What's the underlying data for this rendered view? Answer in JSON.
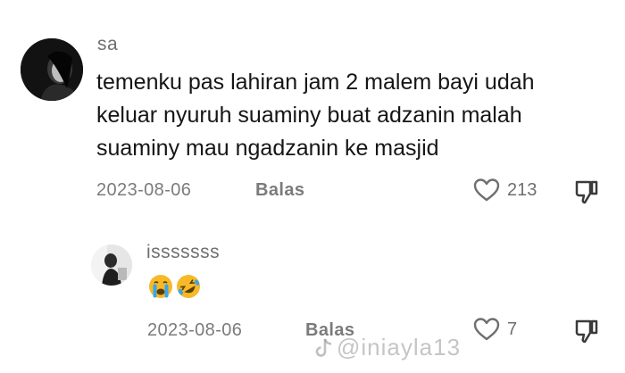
{
  "comment": {
    "username": "sa",
    "text_lines": [
      "temenku pas lahiran jam 2 malem bayi udah",
      "keluar nyuruh suaminy buat adzanin malah",
      "suaminy mau ngadzanin ke masjid"
    ],
    "date": "2023-08-06",
    "reply_label": "Balas",
    "like_count": "213",
    "avatar_icon": "profile-photo-dark"
  },
  "reply": {
    "username": "isssssss",
    "emojis": [
      "crying-face-emoji",
      "rolling-laughing-emoji"
    ],
    "date": "2023-08-06",
    "reply_label": "Balas",
    "like_count": "7",
    "avatar_icon": "profile-photo-light"
  },
  "watermark": {
    "handle": "@iniayla13",
    "icon": "tiktok-logo"
  },
  "colors": {
    "text_primary": "#161616",
    "text_secondary": "#7b7b7b",
    "emoji_yellow": "#f7b928",
    "emoji_tears": "#3aa5ea"
  }
}
